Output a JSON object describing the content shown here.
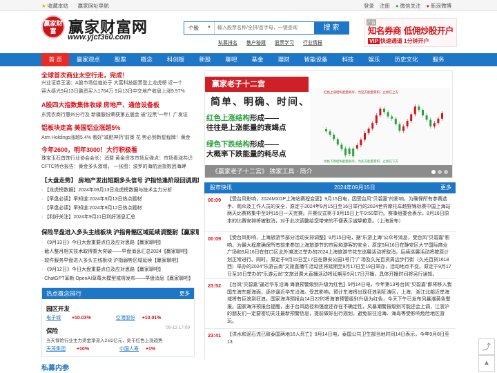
{
  "topbar": {
    "left": [
      "收藏本站",
      "赢家网址导航"
    ],
    "right": [
      "登录",
      "注册",
      "微信关注",
      "新浪微博"
    ]
  },
  "logo": {
    "circle_text": "赢家财富",
    "title": "赢家财富网",
    "url": "www.yjcf360.com"
  },
  "search": {
    "select": "个股",
    "placeholder": "输入股票名称/全拼/首字母，一键查询",
    "button": "搜 索",
    "hotlinks": [
      "私募排名",
      "散户秘籍",
      "股票学习",
      "行业情报"
    ]
  },
  "ad_top": {
    "tag": "广告",
    "line1": "知名券商  低佣炒股开户",
    "vip": "VIP",
    "line2": "快速通道 1分钟开户"
  },
  "nav": [
    "首 页",
    "赢家观点",
    "股票",
    "概念",
    "科创板",
    "新股",
    "聊吧",
    "基金",
    "理财",
    "智能设备",
    "科技",
    "娱乐",
    "历史文化",
    "服务"
  ],
  "left": {
    "h1": "全球首次商业太空行走，完成！",
    "h1_sub1": "兴业证券王涵：A股市场估值处于   大富科技股票登上龙虎榜 近一个",
    "h1_sub2": "容大感光9月13日融资买入1764万    9月13日中交地产收盘上涨9.97%",
    "h2": "A股四大指数集体收绿 房地产、通信设备板",
    "h2_sub1": "东莞农商行惠州分行及  新疆服份荣获第五届金  被\"拉黑\"一年！广发证",
    "h3": "铝板块走高 美国铝业涨超5%",
    "h3_sub1": "Arm Holdings涨超5.4%  看好\"减肥神药\"前景 花  势必到新星程牌！黄金",
    "h4": "今年2600，明年3000！大行积极看",
    "h4_sub1": "珠宝玉石首饰行业协会会长：消费  黄金资本市场反弹点：市场看涨共识",
    "h4_sub2": "CFTC持仓报告：黄金多头激增，    一张图：波罗的海航运指数因海岬",
    "h5": "【大盘走势】 房地产发出短期多头信号 沪指恰逢阶段回调周期",
    "list1": [
      "· 【龙虎榜数据】2024年09月13日龙虎榜数据与技术主力分析",
      "· 【早盘必读】早知道:2024年9月13日热点题材",
      "· 【早盘必读】早知道:2024年9月12日热点题材",
      "· 【利好关注】2024年9月11日利好消息汇总"
    ],
    "h6": "保险早盘进入多头主线板块 沪指骨骼区域延续调整耐【赢家聊",
    "list2": [
      "· 《9月13日》今日大盘重要点位及应对思路【赢家聊吧】",
      "· 截人整月相关技术取得重大突破——早盘消息汇总2024【赢家聊吧】",
      "· 软件服务早盘进入多头主线板块 沪指弱势区域延续【赢家聊吧】",
      "· 《9月12日》今日大盘重要点位及应对思路【赢家聊吧】",
      "· ChatGPT革新 OpenAI草莓大模型或将发布——早盘消息【赢家聊吧】"
    ]
  },
  "hot": {
    "header": "热点概念排行",
    "more": "更多",
    "item1_title": "园区开发",
    "item1_l": "电子城",
    "item1_lv": "+10.03%",
    "item1_r": "空港股份",
    "item1_rv": "+10.01%",
    "date": "09-13 17:09",
    "item2_title": "保险",
    "item2_desc": "当天保险行业主力资金净流入2.82亿元，处于红色上涨趋势",
    "item2_l": "天茂集团",
    "item2_lv": "+10%",
    "item2_r": "中国人寿",
    "item2_rv": "+1%"
  },
  "slide": {
    "flag": "赢家老子十二宫",
    "line1": "简单、明确、时间、价格",
    "line2a": "红色上涨结构",
    "line2b": "形成——",
    "line3": "往往是上涨能量的衰竭点",
    "line4a": "绿色下跌结构",
    "line4b": "形成——",
    "line5": "大概率下跌能量的耗尽点",
    "caption": "《赢家老子十二宫》 独家工具 · 简介",
    "legend1": "红色上涨结构能量耗尽，为空方能量累积，止损在上方",
    "legend2": "绿色下跌结构能量耗尽，为多方能量累积，止损在下方"
  },
  "news": {
    "header": "股市快讯",
    "date": "2024年09月15日",
    "more": "更多",
    "items": [
      {
        "time": "00:09",
        "text": "【受台风影响，2024MXGP上海站赛程变更】9月15日电，因受台风\"贝碧嘉\"的影响，为确保所有参赛选手、观众及工作人员的安全，原定于2024年9月15日至16日举行的2024世界摩托车越野锦标赛中国上海站两天比赛将集中至9月15日一天完赛。开赛仪式将于9月15日上午9:50举行。赛事组委会表示，9月16日原本的比赛安排将被取消，对于此次调整给您带来的不便表示诚挚歉意。（上海发布）"
      },
      {
        "time": "00:09",
        "text": "【受台风影响，上海旅游节部分活动安排调整】9月15日电，据\"乐游上海\"公众号消息，受台风\"贝碧嘉\"影响，为最大程度确保所有前来参加上海旅游节的市民和游客的安全，原定9月16日在静安区大宁国际商业广场和9月16日在虹口区北外滩滨江举办的2024上海旅游节花车巡展活动将取消，后续巡展活动将按原计划正常进行。同时，原定于9月15日至17日在静安公园1号门\"广场及久光百货周边步行街（久光百货1618西）举办的2024\"乐游云尚\"文旅直播牛活动还将延期至9月17日至19日举办，活动地点不变。原定于9月17日至18日举办的\"乐游云尚\"文旅消费大直播活动将延期至9月17日开播，具体开播时间将另行通知。"
      },
      {
        "time": "23:52",
        "text": "【台风\"贝碧嘉\"逼近华东沿海 海浪预警级别升级为红色】9月14日电，今年第13号台风\"贝碧嘉\"即将移入我国东海东部海面，逐步逼近华东沿海。受其影响，预计东海将出现狂浪到狂涛区，上海、浙江北部近岸海域将有巨浪到狂浪。国家海洋预报台14日22时将海浪预警级别升级为红色，今天下午已发布风暴潮黄色警报。国家海洋预报台提醒，由于台风路径和强度还存在不确定性，风暴潮警报级别可能还会上调，江浙沪的朋友们一定要密切关注最新预警信息，提前做好出行规划，避免前往沿海、海岛等受影响危险地区游玩。"
      },
      {
        "time": "23:41",
        "text": "【洪水和泥石流已致泰国两地16人死亡】9月14日电，泰国公共卫生部当地时间14日表示，今年9月8日至13"
      }
    ]
  },
  "bottom_title": "私募内参",
  "colors": {
    "brand_blue": "#1e76c6",
    "accent_red": "#e62c24",
    "headline_red": "#d6121a"
  }
}
